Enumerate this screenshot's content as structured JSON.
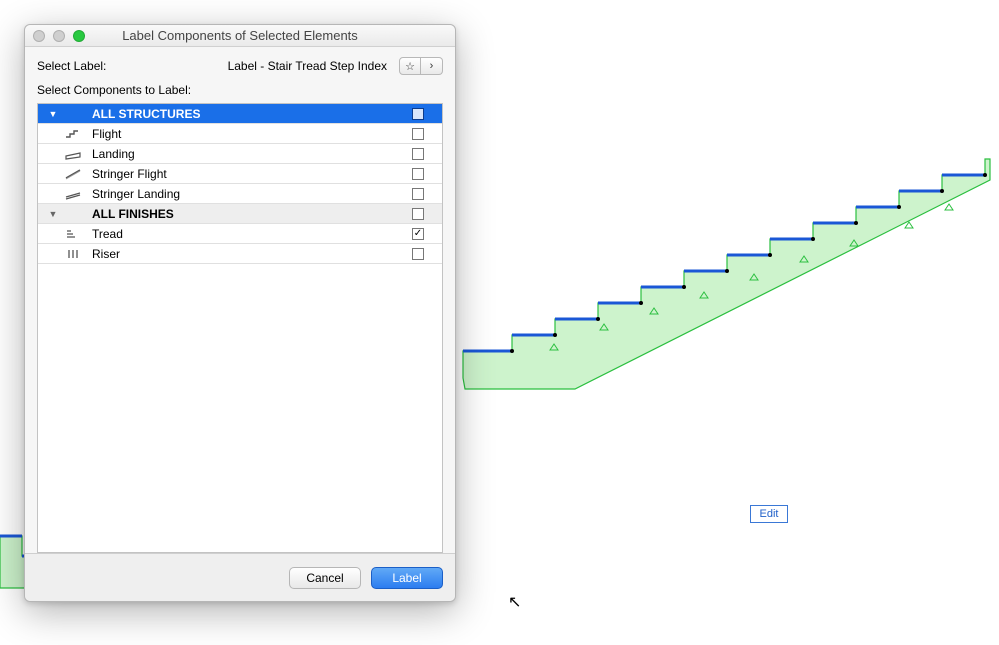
{
  "dialog": {
    "title": "Label Components of Selected Elements",
    "select_label": "Select Label:",
    "label_value": "Label - Stair Tread Step Index",
    "components_header": "Select Components to Label:",
    "star_glyph": "☆",
    "chevron_glyph": "›"
  },
  "groups": [
    {
      "key": "structures",
      "name": "ALL STRUCTURES",
      "selected": true,
      "checked": false,
      "items": [
        {
          "key": "flight",
          "name": "Flight",
          "checked": false
        },
        {
          "key": "landing",
          "name": "Landing",
          "checked": false
        },
        {
          "key": "stringer-flight",
          "name": "Stringer Flight",
          "checked": false
        },
        {
          "key": "stringer-landing",
          "name": "Stringer Landing",
          "checked": false
        }
      ]
    },
    {
      "key": "finishes",
      "name": "ALL FINISHES",
      "selected": false,
      "checked": false,
      "items": [
        {
          "key": "tread",
          "name": "Tread",
          "checked": true
        },
        {
          "key": "riser",
          "name": "Riser",
          "checked": false
        }
      ]
    }
  ],
  "buttons": {
    "cancel": "Cancel",
    "label": "Label"
  },
  "canvas": {
    "edit": "Edit"
  }
}
